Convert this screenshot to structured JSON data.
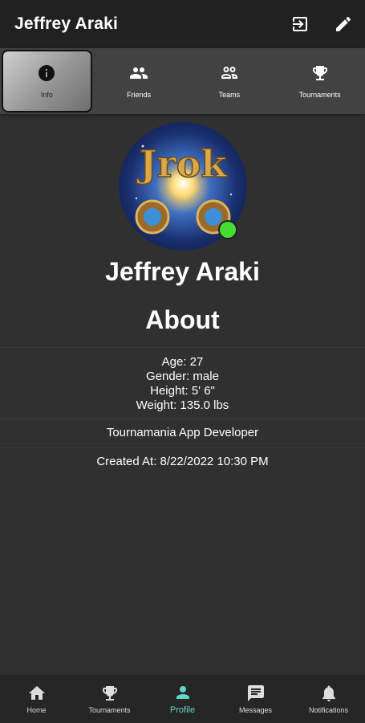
{
  "app_bar": {
    "title": "Jeffrey Araki",
    "actions": [
      {
        "icon": "logout-icon"
      },
      {
        "icon": "pencil-icon"
      }
    ]
  },
  "tabs": [
    {
      "label": "Info",
      "icon": "info-icon",
      "active": true
    },
    {
      "label": "Friends",
      "icon": "people-icon",
      "active": false
    },
    {
      "label": "Teams",
      "icon": "groups-icon",
      "active": false
    },
    {
      "label": "Tournaments",
      "icon": "trophy-icon",
      "active": false
    }
  ],
  "profile": {
    "avatar_text": "Jrok",
    "online": true,
    "name": "Jeffrey Araki"
  },
  "about": {
    "title": "About",
    "age": "Age: 27",
    "gender": "Gender: male",
    "height": "Height: 5' 6\"",
    "weight": "Weight: 135.0 lbs",
    "bio": "Tournamania App Developer",
    "created": "Created At: 8/22/2022 10:30 PM"
  },
  "bottom_nav": [
    {
      "label": "Home",
      "icon": "home-icon",
      "active": false
    },
    {
      "label": "Tournaments",
      "icon": "trophy-icon",
      "active": false
    },
    {
      "label": "Profile",
      "icon": "person-icon",
      "active": true
    },
    {
      "label": "Messages",
      "icon": "message-icon",
      "active": false
    },
    {
      "label": "Notifications",
      "icon": "bell-icon",
      "active": false
    }
  ],
  "colors": {
    "background": "#303030",
    "app_bar": "#212121",
    "tab_bar": "#424242",
    "online": "#44dd33",
    "accent": "#5ed6c8"
  }
}
